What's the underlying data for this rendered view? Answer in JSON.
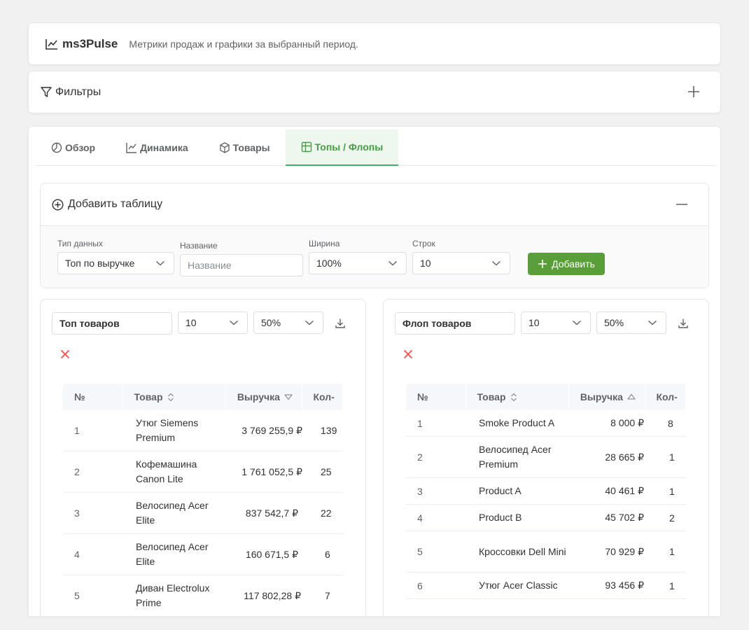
{
  "header": {
    "brand": "ms3Pulse",
    "subtitle": "Метрики продаж и графики за выбранный период."
  },
  "filters": {
    "title": "Фильтры"
  },
  "tabs": [
    {
      "label": "Обзор",
      "icon": "pie-chart-icon"
    },
    {
      "label": "Динамика",
      "icon": "line-chart-icon"
    },
    {
      "label": "Товары",
      "icon": "cube-icon"
    },
    {
      "label": "Топы / Флопы",
      "icon": "grid-icon",
      "active": true
    }
  ],
  "add_table": {
    "title": "Добавить таблицу",
    "type_label": "Тип данных",
    "type_value": "Топ по выручке",
    "name_label": "Название",
    "name_placeholder": "Название",
    "width_label": "Ширина",
    "width_value": "100%",
    "rows_label": "Строк",
    "rows_value": "10",
    "add_button": "Добавить"
  },
  "panels": [
    {
      "title": "Топ товаров",
      "rows": "10",
      "width": "50%",
      "columns": [
        "№",
        "Товар",
        "Выручка",
        "Кол-"
      ],
      "sort": "desc",
      "data": [
        {
          "n": "1",
          "product": "Утюг Siemens Premium",
          "revenue": "3 769 255,9 ₽",
          "qty": "139"
        },
        {
          "n": "2",
          "product": "Кофемашина Canon Lite",
          "revenue": "1 761 052,5 ₽",
          "qty": "25"
        },
        {
          "n": "3",
          "product": "Велосипед Acer Elite",
          "revenue": "837 542,7 ₽",
          "qty": "22"
        },
        {
          "n": "4",
          "product": "Велосипед Acer Elite",
          "revenue": "160 671,5 ₽",
          "qty": "6"
        },
        {
          "n": "5",
          "product": "Диван Electrolux Prime",
          "revenue": "117 802,28 ₽",
          "qty": "7"
        }
      ]
    },
    {
      "title": "Флоп товаров",
      "rows": "10",
      "width": "50%",
      "columns": [
        "№",
        "Товар",
        "Выручка",
        "Кол-"
      ],
      "sort": "asc",
      "data": [
        {
          "n": "1",
          "product": "Smoke Product A",
          "revenue": "8 000 ₽",
          "qty": "8"
        },
        {
          "n": "2",
          "product": "Велосипед Acer Premium",
          "revenue": "28 665 ₽",
          "qty": "1"
        },
        {
          "n": "3",
          "product": "Product A",
          "revenue": "40 461 ₽",
          "qty": "1"
        },
        {
          "n": "4",
          "product": "Product B",
          "revenue": "45 702 ₽",
          "qty": "2"
        },
        {
          "n": "5",
          "product": "Кроссовки Dell Mini",
          "revenue": "70 929 ₽",
          "qty": "1"
        },
        {
          "n": "6",
          "product": "Утюг Acer Classic",
          "revenue": "93 456 ₽",
          "qty": "1"
        }
      ]
    }
  ],
  "colors": {
    "accent": "#5a9e3a",
    "active_tab_text": "#4a9a4a",
    "danger": "#f05050"
  }
}
